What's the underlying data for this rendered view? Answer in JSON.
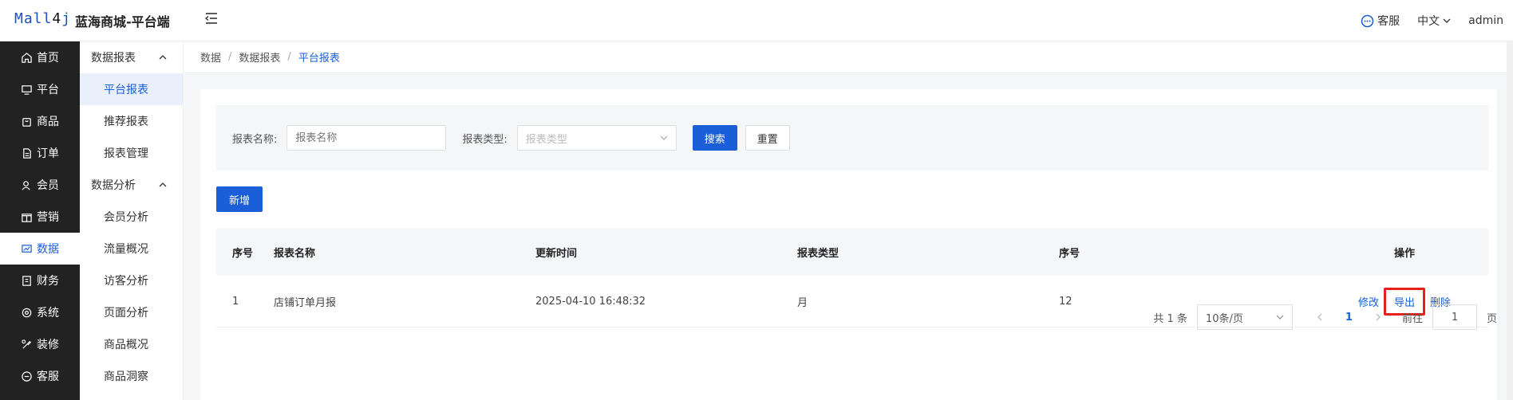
{
  "header": {
    "logo_main": "Mall",
    "logo_num": "4",
    "logo_end": "j",
    "site_name": "蓝海商城-平台端",
    "service": "客服",
    "lang": "中文",
    "user": "admin"
  },
  "main_nav": [
    {
      "label": "首页",
      "icon": "home-icon"
    },
    {
      "label": "平台",
      "icon": "monitor-icon"
    },
    {
      "label": "商品",
      "icon": "bag-icon"
    },
    {
      "label": "订单",
      "icon": "document-icon"
    },
    {
      "label": "会员",
      "icon": "user-icon"
    },
    {
      "label": "营销",
      "icon": "gift-icon"
    },
    {
      "label": "数据",
      "icon": "chart-icon",
      "active": true
    },
    {
      "label": "财务",
      "icon": "wallet-icon"
    },
    {
      "label": "系统",
      "icon": "gear-icon"
    },
    {
      "label": "装修",
      "icon": "brush-icon"
    },
    {
      "label": "客服",
      "icon": "chat-icon"
    }
  ],
  "sub_nav": {
    "group1": "数据报表",
    "items1": [
      "平台报表",
      "推荐报表",
      "报表管理"
    ],
    "group2": "数据分析",
    "items2": [
      "会员分析",
      "流量概况",
      "访客分析",
      "页面分析",
      "商品概况",
      "商品洞察"
    ]
  },
  "breadcrumb": [
    "数据",
    "数据报表",
    "平台报表"
  ],
  "search": {
    "name_label": "报表名称:",
    "name_placeholder": "报表名称",
    "type_label": "报表类型:",
    "type_placeholder": "报表类型",
    "search_btn": "搜索",
    "reset_btn": "重置"
  },
  "add_btn": "新增",
  "table": {
    "headers": [
      "序号",
      "报表名称",
      "更新时间",
      "报表类型",
      "序号",
      "操作"
    ],
    "rows": [
      {
        "index": "1",
        "name": "店铺订单月报",
        "updated": "2025-04-10 16:48:32",
        "type": "月",
        "seq": "12",
        "ops": [
          "修改",
          "导出",
          "删除"
        ]
      }
    ]
  },
  "pager": {
    "total": "共 1 条",
    "page_size": "10条/页",
    "current": "1",
    "goto_label": "前往",
    "goto_value": "1",
    "page_unit": "页"
  },
  "colors": {
    "accent": "#1a5fd8",
    "highlight": "#e8201c",
    "sidebar": "#222222"
  }
}
